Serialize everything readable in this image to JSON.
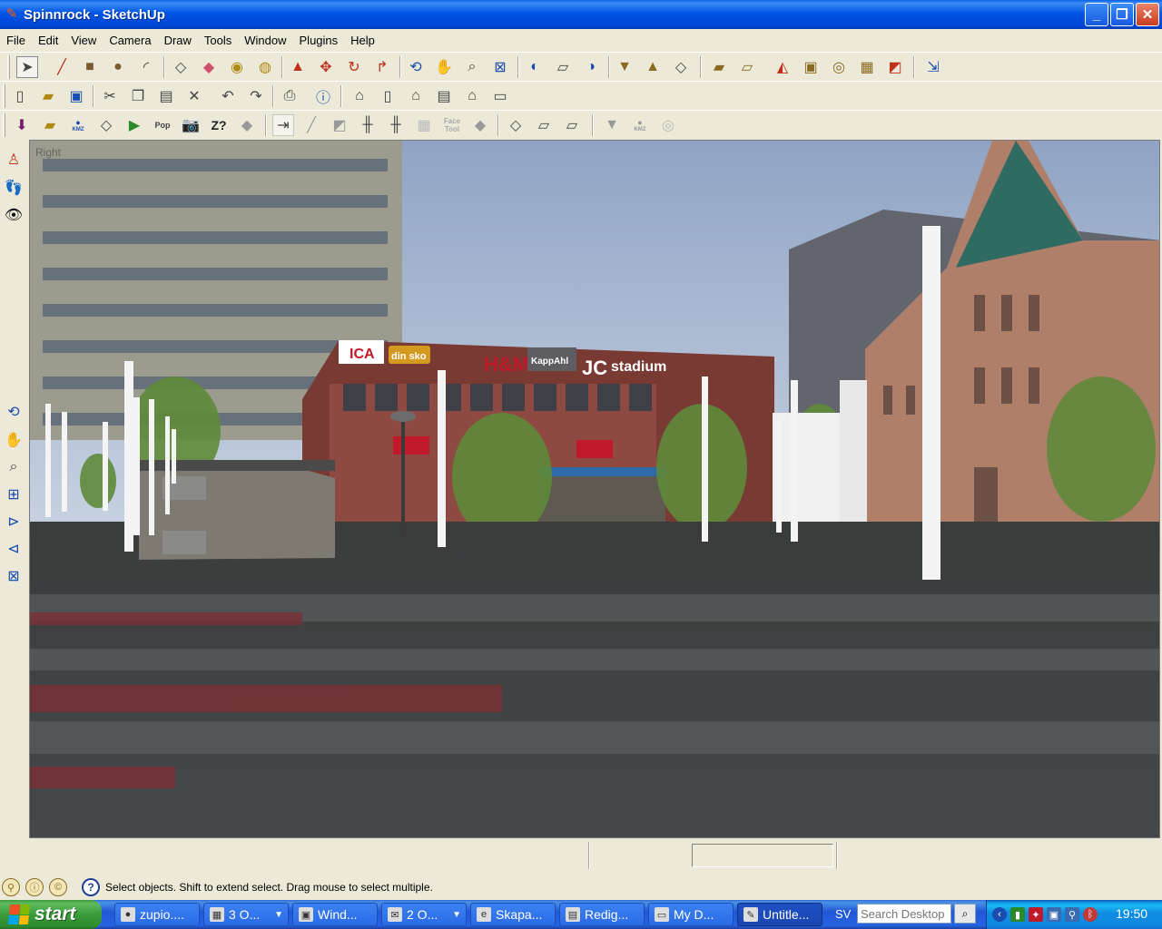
{
  "window": {
    "title": "Spinnrock - SketchUp",
    "minimize_glyph": "_",
    "maximize_glyph": "❐",
    "close_glyph": "✕"
  },
  "menu": [
    "File",
    "Edit",
    "View",
    "Camera",
    "Draw",
    "Tools",
    "Window",
    "Plugins",
    "Help"
  ],
  "toolbar_labels": {
    "kmz1": "KMZ",
    "pop": "Pop",
    "z": "Z?",
    "face_tool": "Face Tool",
    "kmz2": "KMZ"
  },
  "viewport": {
    "view_name": "Right",
    "scene_signs": [
      "ICA",
      "din sko",
      "H&M",
      "KappAhl",
      "JC",
      "stadium"
    ]
  },
  "status": {
    "message": "Select objects. Shift to extend select. Drag mouse to select multiple.",
    "help_glyph": "?"
  },
  "taskbar": {
    "start_label": "start",
    "tasks": [
      {
        "label": "zupio....",
        "active": false
      },
      {
        "label": "3 O...",
        "active": false
      },
      {
        "label": "Wind...",
        "active": false
      },
      {
        "label": "2 O...",
        "active": false
      },
      {
        "label": "Skapa...",
        "active": false
      },
      {
        "label": "Redig...",
        "active": false
      },
      {
        "label": "My D...",
        "active": false
      },
      {
        "label": "Untitle...",
        "active": true
      }
    ],
    "language": "SV",
    "search_placeholder": "Search Desktop",
    "clock": "19:50"
  }
}
